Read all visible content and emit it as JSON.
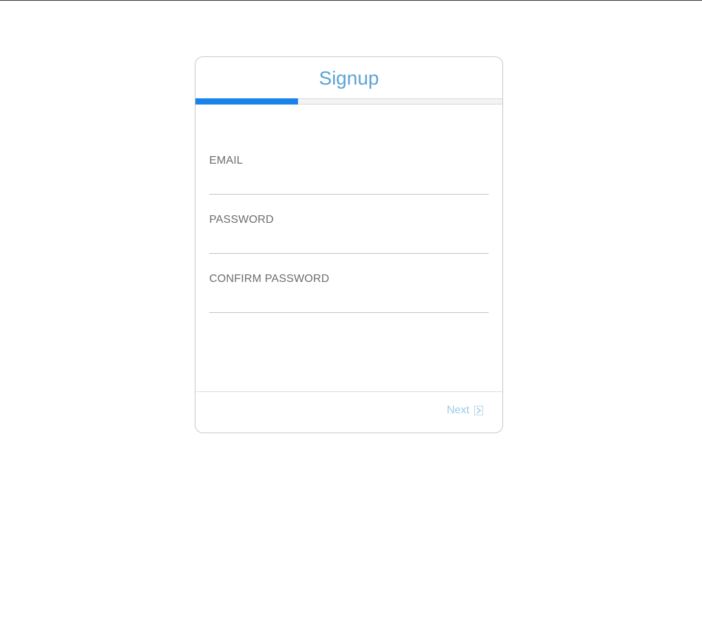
{
  "form": {
    "title": "Signup",
    "progress_fraction": 0.333,
    "fields": [
      {
        "label": "EMAIL",
        "value": ""
      },
      {
        "label": "PASSWORD",
        "value": ""
      },
      {
        "label": "CONFIRM PASSWORD",
        "value": ""
      }
    ],
    "next_label": "Next",
    "next_icon": "chevron-right-icon"
  },
  "colors": {
    "accent": "#1a82e8",
    "title": "#5aa3d6",
    "next": "#9ccbe8"
  }
}
